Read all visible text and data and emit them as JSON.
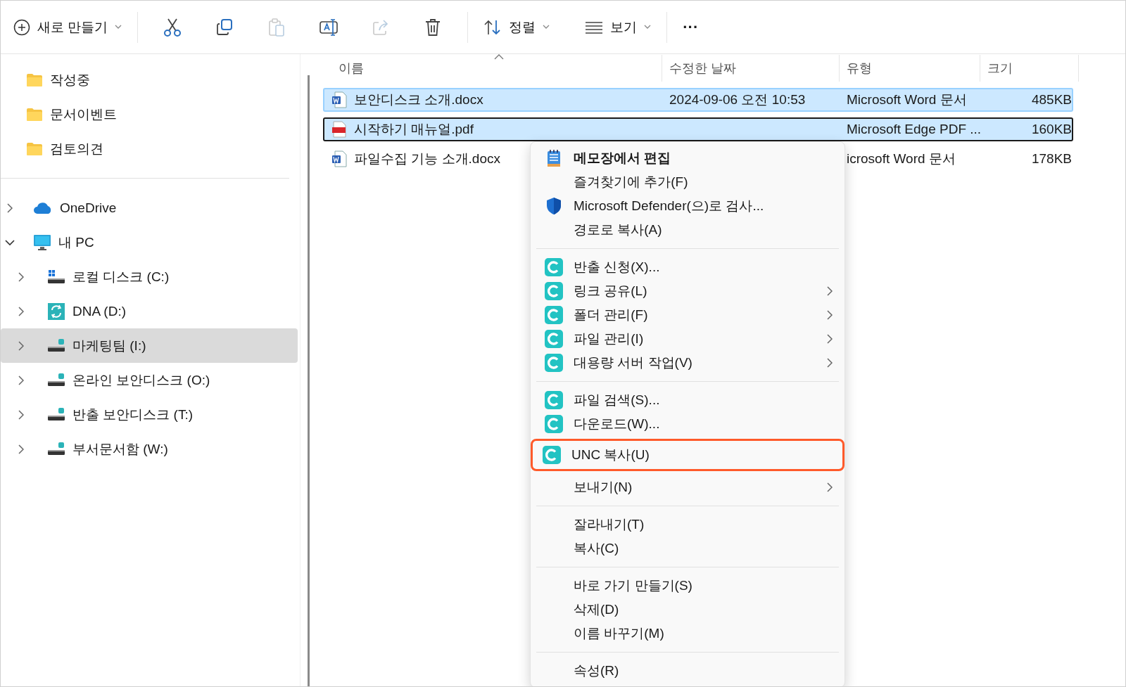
{
  "toolbar": {
    "new_button": {
      "label": "새로 만들기"
    },
    "actions": [
      {
        "kind": "cut",
        "disabled": false
      },
      {
        "kind": "copy",
        "disabled": false
      },
      {
        "kind": "paste",
        "disabled": true
      },
      {
        "kind": "rename",
        "disabled": false
      },
      {
        "kind": "share",
        "disabled": true
      },
      {
        "kind": "delete",
        "disabled": false
      }
    ],
    "sort_button": {
      "label": "정렬"
    },
    "view_button": {
      "label": "보기"
    },
    "more_button": {
      "label": "···"
    }
  },
  "sidebar": {
    "quick_access": [
      {
        "label": "작성중"
      },
      {
        "label": "문서이벤트"
      },
      {
        "label": "검토의견"
      }
    ],
    "tree": [
      {
        "label": "OneDrive",
        "kind": "cloud",
        "expanded": false,
        "selected": false
      },
      {
        "label": "내 PC",
        "kind": "pc",
        "expanded": true,
        "selected": false,
        "children": [
          {
            "label": "로컬 디스크 (C:)",
            "kind": "system-drive",
            "expanded": false,
            "selected": false
          },
          {
            "label": "DNA (D:)",
            "kind": "sync-drive",
            "expanded": false,
            "selected": false
          },
          {
            "label": "마케팅팀 (I:)",
            "kind": "network-drive",
            "expanded": false,
            "selected": true
          },
          {
            "label": "온라인 보안디스크 (O:)",
            "kind": "network-drive",
            "expanded": false,
            "selected": false
          },
          {
            "label": "반출 보안디스크 (T:)",
            "kind": "network-drive",
            "expanded": false,
            "selected": false
          },
          {
            "label": "부서문서함 (W:)",
            "kind": "network-drive",
            "expanded": false,
            "selected": false
          }
        ]
      }
    ]
  },
  "file_list": {
    "columns": [
      "이름",
      "수정한 날짜",
      "유형",
      "크기"
    ],
    "rows": [
      {
        "kind": "word",
        "name": "보안디스크 소개.docx",
        "modified": "2024-09-06 오전 10:53",
        "type": "Microsoft Word 문서",
        "size": "485KB",
        "selected": true,
        "focused": false
      },
      {
        "kind": "pdf",
        "name": "시작하기 매뉴얼.pdf",
        "type": "Microsoft Edge PDF ...",
        "size": "160KB",
        "selected": true,
        "focused": true
      },
      {
        "kind": "word",
        "name": "파일수집 기능 소개.docx",
        "type": "icrosoft Word 문서",
        "size": "178KB",
        "selected": false,
        "focused": false
      }
    ]
  },
  "context_menu": {
    "groups": [
      [
        {
          "label": "메모장에서 편집",
          "kind": "notepad",
          "bold": true,
          "submenu": false,
          "highlighted": false
        },
        {
          "label": "즐겨찾기에 추가(F)",
          "kind": "plain",
          "bold": false,
          "submenu": false,
          "highlighted": false
        },
        {
          "label": "Microsoft Defender(으)로 검사...",
          "kind": "shield",
          "bold": false,
          "submenu": false,
          "highlighted": false
        },
        {
          "label": "경로로 복사(A)",
          "kind": "plain",
          "bold": false,
          "submenu": false,
          "highlighted": false
        }
      ],
      [
        {
          "label": "반출 신청(X)...",
          "kind": "app",
          "bold": false,
          "submenu": false,
          "highlighted": false
        },
        {
          "label": "링크 공유(L)",
          "kind": "app",
          "bold": false,
          "submenu": true,
          "highlighted": false
        },
        {
          "label": "폴더 관리(F)",
          "kind": "app",
          "bold": false,
          "submenu": true,
          "highlighted": false
        },
        {
          "label": "파일 관리(I)",
          "kind": "app",
          "bold": false,
          "submenu": true,
          "highlighted": false
        },
        {
          "label": "대용량 서버 작업(V)",
          "kind": "app",
          "bold": false,
          "submenu": true,
          "highlighted": false
        }
      ],
      [
        {
          "label": "파일 검색(S)...",
          "kind": "app",
          "bold": false,
          "submenu": false,
          "highlighted": false
        },
        {
          "label": "다운로드(W)...",
          "kind": "app",
          "bold": false,
          "submenu": false,
          "highlighted": false
        },
        {
          "label": "UNC 복사(U)",
          "kind": "app",
          "bold": false,
          "submenu": false,
          "highlighted": true
        },
        {
          "label": "보내기(N)",
          "kind": "plain",
          "bold": false,
          "submenu": true,
          "highlighted": false
        }
      ],
      [
        {
          "label": "잘라내기(T)",
          "kind": "plain",
          "bold": false,
          "submenu": false,
          "highlighted": false
        },
        {
          "label": "복사(C)",
          "kind": "plain",
          "bold": false,
          "submenu": false,
          "highlighted": false
        }
      ],
      [
        {
          "label": "바로 가기 만들기(S)",
          "kind": "plain",
          "bold": false,
          "submenu": false,
          "highlighted": false
        },
        {
          "label": "삭제(D)",
          "kind": "plain",
          "bold": false,
          "submenu": false,
          "highlighted": false
        },
        {
          "label": "이름 바꾸기(M)",
          "kind": "plain",
          "bold": false,
          "submenu": false,
          "highlighted": false
        }
      ],
      [
        {
          "label": "속성(R)",
          "kind": "plain",
          "bold": false,
          "submenu": false,
          "highlighted": false
        }
      ]
    ]
  }
}
